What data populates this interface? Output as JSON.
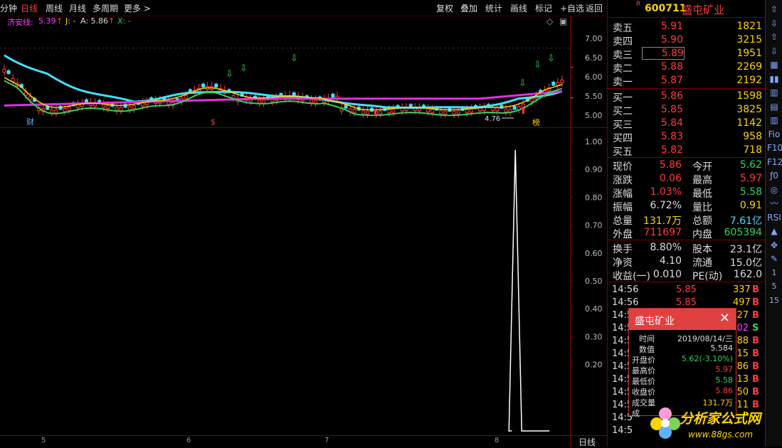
{
  "topbar": {
    "left": [
      {
        "label": "分钟",
        "active": false
      },
      {
        "label": "日线",
        "active": true
      },
      {
        "label": "周线",
        "active": false
      },
      {
        "label": "月线",
        "active": false
      },
      {
        "label": "多周期",
        "active": false
      },
      {
        "label": "更多 >",
        "active": false
      }
    ],
    "right": [
      "复权",
      "叠加",
      "统计",
      "画线",
      "标记",
      "+自选",
      "返回"
    ]
  },
  "indicator": {
    "name": "济安线:",
    "value": "5.39",
    "value_arrow": "↑",
    "j_label": "J: -",
    "a_label": "A: 5.86",
    "a_arrow": "↑",
    "x_label": "X: -"
  },
  "chart_data": [
    {
      "type": "candlestick",
      "ylim": [
        4.7,
        7.3
      ],
      "y_ticks": [
        "7.00",
        "6.50",
        "6.00",
        "5.50",
        "5.00"
      ],
      "annotations": [
        "财",
        "$",
        "榜",
        "4.76"
      ],
      "low_marker": "4.76"
    },
    {
      "type": "line",
      "ylim": [
        0,
        1.05
      ],
      "y_ticks": [
        "1.00",
        "0.90",
        "0.80",
        "0.70",
        "0.60",
        "0.50",
        "0.40",
        "0.30",
        "0.20"
      ],
      "x_ticks": [
        "5",
        "6",
        "7",
        "8"
      ],
      "x_count": 160,
      "series": [
        {
          "values": [
            0,
            0,
            0,
            0,
            0,
            0,
            0,
            0,
            0,
            0,
            0,
            0,
            0,
            0,
            0,
            0,
            0,
            0,
            0,
            0,
            0,
            0,
            0,
            0,
            0,
            0,
            0,
            0,
            0,
            0,
            0,
            0,
            0,
            0,
            0,
            0,
            0,
            0,
            0,
            0,
            0,
            0,
            0,
            0,
            0,
            0,
            0,
            0,
            0,
            0,
            0,
            0,
            0,
            0,
            0,
            0,
            0,
            0,
            0,
            0,
            0,
            0,
            0,
            0,
            0,
            0,
            0,
            0,
            0,
            0,
            0,
            0,
            0,
            0,
            0,
            0,
            0,
            0,
            0,
            0,
            0,
            0,
            0,
            0,
            0,
            0,
            0,
            0,
            0,
            0,
            0,
            0,
            0,
            0,
            0,
            0,
            0,
            0,
            0,
            0,
            0,
            0,
            0,
            0,
            0,
            0,
            0,
            0,
            0,
            0,
            0,
            0,
            0,
            0,
            0,
            0,
            0,
            0,
            0,
            0,
            0,
            0,
            0,
            0,
            0,
            0,
            0,
            0,
            0,
            0,
            0,
            0,
            0,
            0,
            0,
            0,
            0,
            0,
            0,
            0,
            0,
            0,
            0,
            0,
            0,
            0,
            1,
            0,
            0,
            0,
            0,
            0,
            0,
            0,
            0,
            0,
            0,
            0,
            0,
            0
          ]
        }
      ]
    }
  ],
  "period_label": "日线",
  "quote": {
    "flag": "R",
    "code": "600711",
    "name": "盛屯矿业",
    "asks": [
      {
        "label": "卖五",
        "price": "5.91",
        "vol": "1821"
      },
      {
        "label": "卖四",
        "price": "5.90",
        "vol": "3215"
      },
      {
        "label": "卖三",
        "price": "5.89",
        "vol": "1951"
      },
      {
        "label": "卖二",
        "price": "5.88",
        "vol": "2269"
      },
      {
        "label": "卖一",
        "price": "5.87",
        "vol": "2192"
      }
    ],
    "bids": [
      {
        "label": "买一",
        "price": "5.86",
        "vol": "1598"
      },
      {
        "label": "买二",
        "price": "5.85",
        "vol": "3825"
      },
      {
        "label": "买三",
        "price": "5.84",
        "vol": "1142"
      },
      {
        "label": "买四",
        "price": "5.83",
        "vol": "958"
      },
      {
        "label": "买五",
        "price": "5.82",
        "vol": "718"
      }
    ],
    "stats1": [
      {
        "l1": "现价",
        "v1": "5.86",
        "c1": "red",
        "l2": "今开",
        "v2": "5.62",
        "c2": "green"
      },
      {
        "l1": "涨跌",
        "v1": "0.06",
        "c1": "red",
        "l2": "最高",
        "v2": "5.97",
        "c2": "red"
      },
      {
        "l1": "涨幅",
        "v1": "1.03%",
        "c1": "red",
        "l2": "最低",
        "v2": "5.58",
        "c2": "green"
      },
      {
        "l1": "振幅",
        "v1": "6.72%",
        "c1": "white",
        "l2": "量比",
        "v2": "0.91",
        "c2": "yellow"
      },
      {
        "l1": "总量",
        "v1": "131.7万",
        "c1": "yellow",
        "l2": "总额",
        "v2": "7.61亿",
        "c2": "cyan"
      },
      {
        "l1": "外盘",
        "v1": "711697",
        "c1": "red",
        "l2": "内盘",
        "v2": "605394",
        "c2": "green"
      }
    ],
    "stats2": [
      {
        "l1": "换手",
        "v1": "8.80%",
        "c1": "white",
        "l2": "股本",
        "v2": "23.1亿",
        "c2": "white"
      },
      {
        "l1": "净资",
        "v1": "4.10",
        "c1": "white",
        "l2": "流通",
        "v2": "15.0亿",
        "c2": "white"
      },
      {
        "l1": "收益(一)",
        "v1": "0.010",
        "c1": "white",
        "l2": "PE(动)",
        "v2": "162.0",
        "c2": "white"
      }
    ],
    "ticks": [
      {
        "t": "14:56",
        "p": "5.85",
        "v": "337",
        "s": "B"
      },
      {
        "t": "14:56",
        "p": "5.85",
        "v": "497",
        "s": "B"
      },
      {
        "t": "14:5",
        "p": "",
        "v": "27",
        "s": "B"
      },
      {
        "t": "14:5",
        "p": "",
        "v": "02",
        "s": "S"
      },
      {
        "t": "14:5",
        "p": "",
        "v": "88",
        "s": "B"
      },
      {
        "t": "14:5",
        "p": "",
        "v": "15",
        "s": "B"
      },
      {
        "t": "14:5",
        "p": "",
        "v": "86",
        "s": "B"
      },
      {
        "t": "14:5",
        "p": "",
        "v": "13",
        "s": "B"
      },
      {
        "t": "14:5",
        "p": "",
        "v": "50",
        "s": "B"
      },
      {
        "t": "14:5",
        "p": "",
        "v": "11",
        "s": "B"
      },
      {
        "t": "14:5",
        "p": "",
        "v": "",
        "s": ""
      },
      {
        "t": "14:5",
        "p": "",
        "v": "",
        "s": ""
      }
    ]
  },
  "popup": {
    "title": "盛屯矿业",
    "rows": [
      {
        "k": "时间",
        "v": "2019/08/14/三",
        "c": "white"
      },
      {
        "k": "数值",
        "v": "5.584",
        "c": "white"
      },
      {
        "k": "开盘价",
        "v": "5.62(-3.10%)",
        "c": "green"
      },
      {
        "k": "最高价",
        "v": "5.97",
        "c": "red"
      },
      {
        "k": "最低价",
        "v": "5.58",
        "c": "green"
      },
      {
        "k": "收盘价",
        "v": "5.86",
        "c": "red"
      },
      {
        "k": "成交量",
        "v": "131.7万",
        "c": "yellow"
      },
      {
        "k": "成",
        "v": "",
        "c": "white"
      }
    ]
  },
  "toolbar": [
    "⇧",
    "⇩",
    "⇧",
    "⇩",
    "▦",
    "▮▮",
    "▥",
    "▤",
    "▥",
    "Fio",
    "F10",
    "F12",
    "ƒ0",
    "◎",
    "〰",
    "RSI",
    "▲",
    "✥",
    "✎",
    "1",
    "5",
    "15"
  ],
  "watermark": {
    "text": "分析家公式网",
    "url": "www.88gs.com"
  }
}
